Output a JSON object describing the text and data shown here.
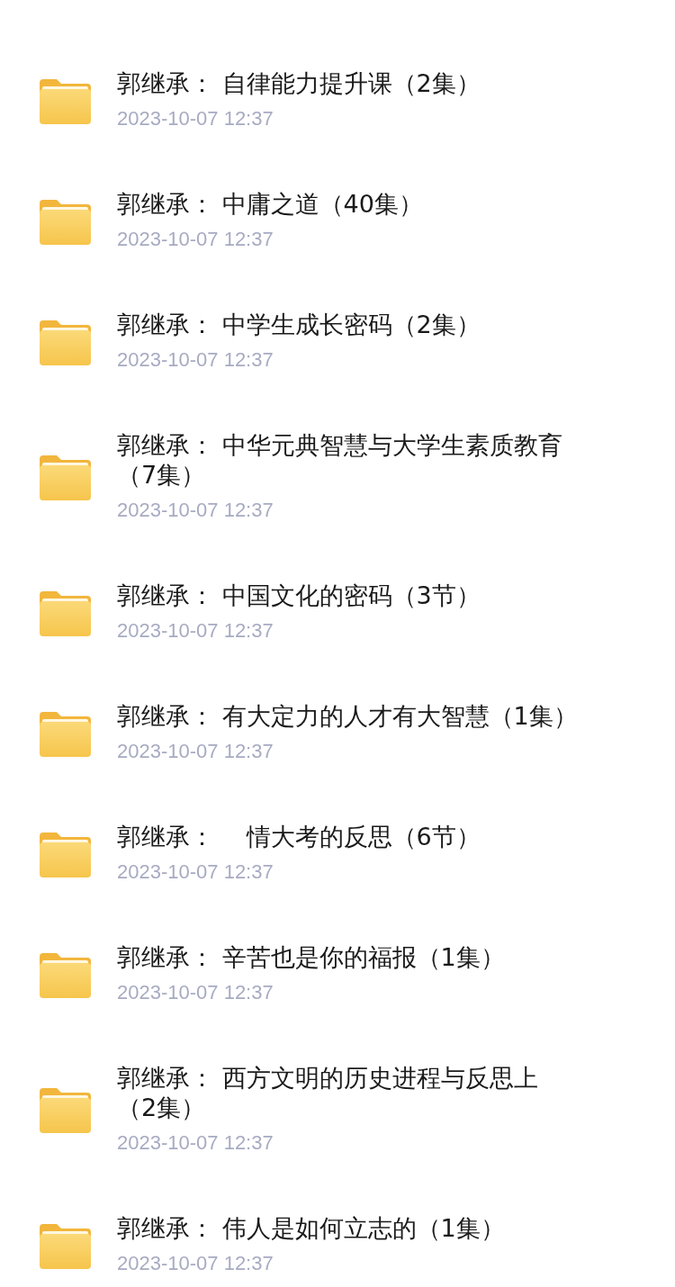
{
  "folders": [
    {
      "title": "郭继承： 自律能力提升课（2集）",
      "date": "2023-10-07 12:37"
    },
    {
      "title": "郭继承： 中庸之道（40集）",
      "date": "2023-10-07 12:37"
    },
    {
      "title": "郭继承： 中学生成长密码（2集）",
      "date": "2023-10-07 12:37"
    },
    {
      "title": "郭继承： 中华元典智慧与大学生素质教育（7集）",
      "date": "2023-10-07 12:37"
    },
    {
      "title": "郭继承： 中国文化的密码（3节）",
      "date": "2023-10-07 12:37"
    },
    {
      "title": "郭继承： 有大定力的人才有大智慧（1集）",
      "date": "2023-10-07 12:37"
    },
    {
      "title": "郭继承： 　情大考的反思（6节）",
      "date": "2023-10-07 12:37"
    },
    {
      "title": "郭继承： 辛苦也是你的福报（1集）",
      "date": "2023-10-07 12:37"
    },
    {
      "title": "郭继承： 西方文明的历史进程与反思上（2集）",
      "date": "2023-10-07 12:37"
    },
    {
      "title": "郭继承： 伟人是如何立志的（1集）",
      "date": "2023-10-07 12:37"
    }
  ]
}
